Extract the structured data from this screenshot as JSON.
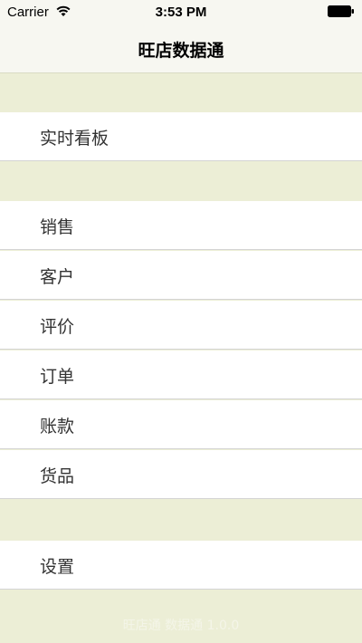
{
  "status_bar": {
    "carrier": "Carrier",
    "time": "3:53 PM",
    "wifi_icon": "wifi-icon",
    "battery_icon": "battery-icon"
  },
  "nav": {
    "title": "旺店数据通"
  },
  "sections": [
    {
      "items": [
        {
          "label": "实时看板"
        }
      ]
    },
    {
      "items": [
        {
          "label": "销售"
        },
        {
          "label": "客户"
        },
        {
          "label": "评价"
        },
        {
          "label": "订单"
        },
        {
          "label": "账款"
        },
        {
          "label": "货品"
        }
      ]
    },
    {
      "items": [
        {
          "label": "设置"
        }
      ]
    }
  ],
  "footer": {
    "text": "旺店通 数据通 1.0.0"
  },
  "colors": {
    "group_background": "#eceed6",
    "bar_background": "#f7f7f1",
    "cell_background": "#ffffff",
    "text": "#333333"
  }
}
